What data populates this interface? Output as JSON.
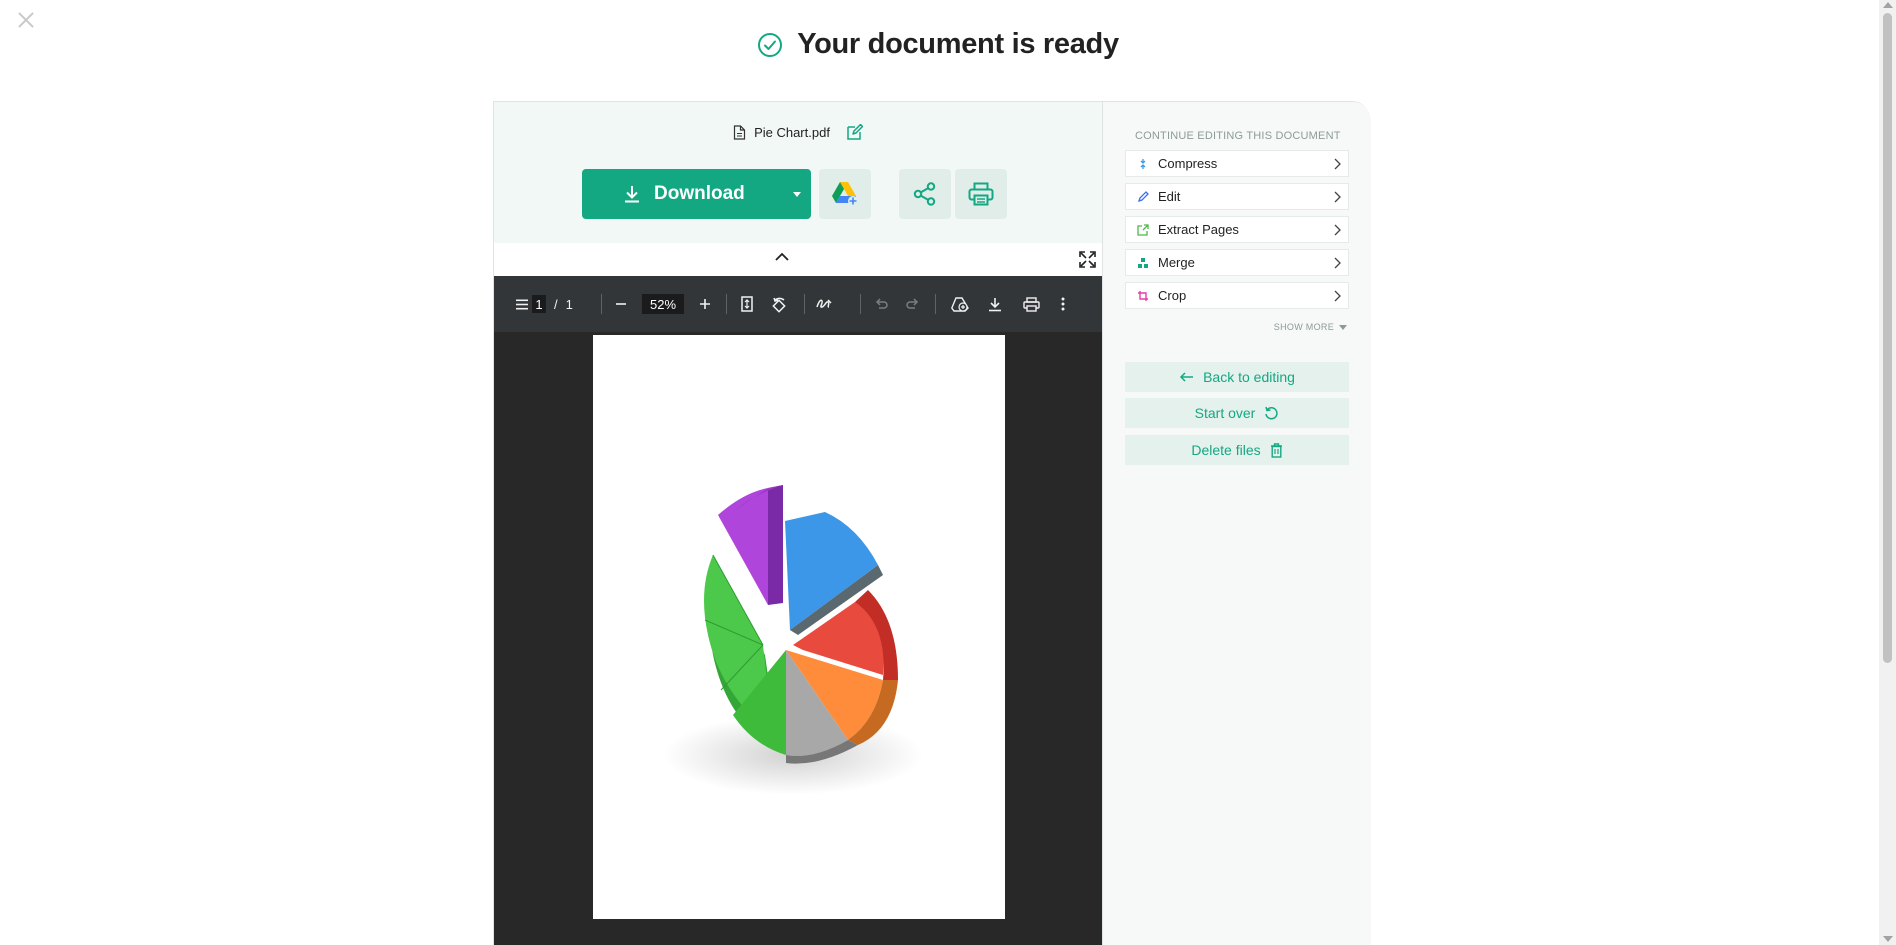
{
  "header": {
    "title": "Your document is ready"
  },
  "file": {
    "name": "Pie Chart.pdf"
  },
  "actions": {
    "download_label": "Download"
  },
  "viewer": {
    "current_page": "1",
    "page_separator": "/",
    "total_pages": "1",
    "zoom": "52%"
  },
  "sidebar": {
    "section_label": "CONTINUE EDITING THIS DOCUMENT",
    "tools": [
      {
        "label": "Compress",
        "icon": "compress-icon",
        "color": "#3b9be8"
      },
      {
        "label": "Edit",
        "icon": "edit-icon",
        "color": "#3b6fe8"
      },
      {
        "label": "Extract Pages",
        "icon": "extract-pages-icon",
        "color": "#4bb84a"
      },
      {
        "label": "Merge",
        "icon": "merge-icon",
        "color": "#14a882"
      },
      {
        "label": "Crop",
        "icon": "crop-icon",
        "color": "#e83ba8"
      }
    ],
    "show_more": "SHOW MORE",
    "back_label": "Back to editing",
    "start_over_label": "Start over",
    "delete_label": "Delete files"
  },
  "colors": {
    "accent": "#14a882",
    "toolbar": "#323639",
    "viewer_bg": "#282828"
  }
}
